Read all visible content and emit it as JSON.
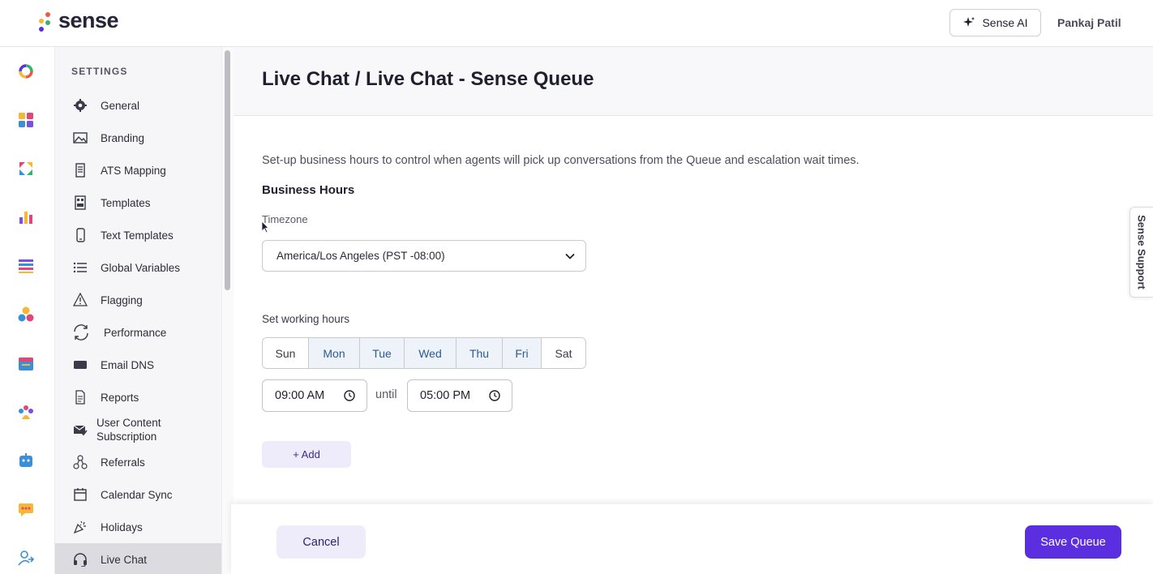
{
  "app": {
    "logo_text": "sense",
    "ai_button": "Sense AI",
    "user_name": "Pankaj Patil"
  },
  "rail": {
    "icons": [
      "donut-icon",
      "apps-grid-icon",
      "arrows-icon",
      "bar-chart-icon",
      "list-icon",
      "circles-icon",
      "calendar-icon",
      "team-icon",
      "bot-icon",
      "chat-bubble-icon",
      "user-transfer-icon"
    ]
  },
  "sidebar": {
    "title": "SETTINGS",
    "items": [
      {
        "label": "General",
        "icon": "gear-icon"
      },
      {
        "label": "Branding",
        "icon": "image-icon"
      },
      {
        "label": "ATS Mapping",
        "icon": "document-icon"
      },
      {
        "label": "Templates",
        "icon": "template-icon"
      },
      {
        "label": "Text Templates",
        "icon": "phone-icon"
      },
      {
        "label": "Global Variables",
        "icon": "list-icon"
      },
      {
        "label": "Flagging",
        "icon": "warning-icon"
      },
      {
        "label": "Performance",
        "icon": "refresh-icon"
      },
      {
        "label": "Email DNS",
        "icon": "envelope-icon"
      },
      {
        "label": "Reports",
        "icon": "report-icon"
      },
      {
        "label": "User Content Subscription",
        "icon": "mail-check-icon"
      },
      {
        "label": "Referrals",
        "icon": "network-icon"
      },
      {
        "label": "Calendar Sync",
        "icon": "calendar-icon"
      },
      {
        "label": "Holidays",
        "icon": "party-icon"
      },
      {
        "label": "Live Chat",
        "icon": "headset-icon"
      }
    ]
  },
  "main": {
    "title": "Live Chat / Live Chat - Sense Queue",
    "description": "Set-up business hours to control when agents will pick up conversations from the Queue and escalation wait times.",
    "section_title": "Business Hours",
    "timezone_label": "Timezone",
    "timezone_value": "America/Los Angeles (PST -08:00)",
    "working_hours_label": "Set working hours",
    "days": [
      {
        "label": "Sun",
        "selected": false
      },
      {
        "label": "Mon",
        "selected": true
      },
      {
        "label": "Tue",
        "selected": true
      },
      {
        "label": "Wed",
        "selected": true
      },
      {
        "label": "Thu",
        "selected": true
      },
      {
        "label": "Fri",
        "selected": true
      },
      {
        "label": "Sat",
        "selected": false
      }
    ],
    "start_time": "09:00 AM",
    "until_label": "until",
    "end_time": "05:00 PM",
    "add_button": "+ Add"
  },
  "footer": {
    "cancel_button": "Cancel",
    "save_button": "Save Queue"
  },
  "support_tab": "Sense Support",
  "colors": {
    "accent": "#5b2ee0",
    "accent_soft": "#eeebfa",
    "day_selected_bg": "#eef3fa",
    "day_selected_text": "#2c5a94"
  }
}
